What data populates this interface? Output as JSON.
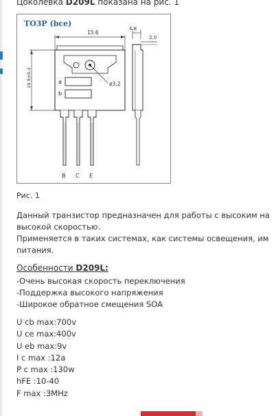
{
  "article": {
    "intro_prefix": "Цоколевка ",
    "intro_model": "D209L",
    "intro_suffix": " показана на рис. 1",
    "figure": {
      "package_label": "TO3P (bce)",
      "dim_width": "15.6",
      "dim_height": "19.9±0.3",
      "dim_side_top": "4.8",
      "dim_side_tab": "2.0",
      "dim_hole": "ø3.2",
      "marker_a": "a",
      "marker_b": "b",
      "pin_b": "B",
      "pin_c": "C",
      "pin_e": "E"
    },
    "caption": "Рис. 1",
    "description": [
      "Данный транзистор предназначен для работы с высоким на",
      "высокой скоростью.",
      "Применяется в таких системах, как системы освещения, им",
      "питания."
    ],
    "features_prefix": "Особенности ",
    "features_model": "D209L:",
    "features": [
      "-Очень высокая скорость переключения",
      "-Поддержка высокого напряжения",
      "-Широкое обратное смещения SOA"
    ],
    "params": [
      "U cb max:700v",
      "U ce max:400v",
      "U eb max:9v",
      "I c max :12a",
      "P c max :130w",
      "hFE :10-40",
      "F max :3MHz"
    ]
  },
  "colors": {
    "accent_blue": "#2a7fb8",
    "package_label": "#2a5db0",
    "bottom_bar": "#d23030"
  }
}
